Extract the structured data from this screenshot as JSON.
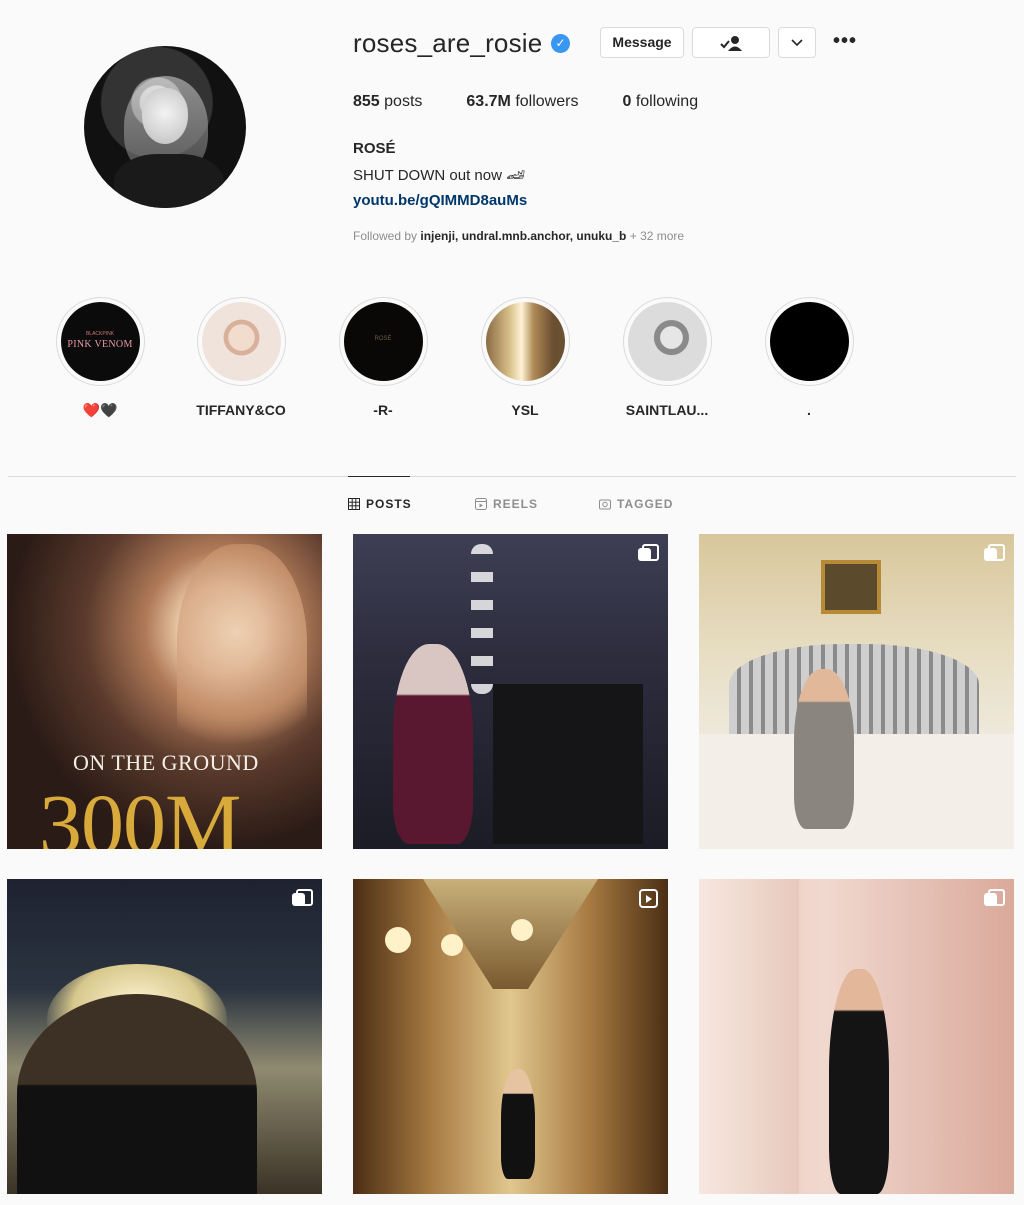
{
  "profile": {
    "username": "roses_are_rosie",
    "verified": true,
    "buttons": {
      "message": "Message"
    },
    "stats": {
      "posts": "855",
      "posts_label": "posts",
      "followers": "63.7M",
      "followers_label": "followers",
      "following": "0",
      "following_label": "following"
    },
    "full_name": "ROSÉ",
    "bio": "SHUT DOWN out now 🏎",
    "link": "youtu.be/gQIMMD8auMs",
    "followed_by_prefix": "Followed by",
    "followed_by_names": "injenji, undral.mnb.anchor, unuku_b",
    "followed_by_more": "+ 32 more"
  },
  "highlights": [
    {
      "label": "❤️🖤",
      "cover_text": "PINK VENOM",
      "cover_sub": "BLACKPINK"
    },
    {
      "label": "TIFFANY&CO"
    },
    {
      "label": "-R-",
      "cover_text": "ROSÉ"
    },
    {
      "label": "YSL"
    },
    {
      "label": "SAINTLAU..."
    },
    {
      "label": "."
    }
  ],
  "tabs": [
    {
      "label": "POSTS",
      "active": true,
      "icon": "grid-icon"
    },
    {
      "label": "REELS",
      "active": false,
      "icon": "reels-icon"
    },
    {
      "label": "TAGGED",
      "active": false,
      "icon": "tagged-icon"
    }
  ],
  "posts": [
    {
      "overlay_line1": "ON THE GROUND",
      "overlay_line2": "300M",
      "badge": "none"
    },
    {
      "badge": "multi-icon"
    },
    {
      "badge": "multi-icon"
    },
    {
      "badge": "multi-icon"
    },
    {
      "badge": "reel-icon"
    },
    {
      "badge": "multi-icon"
    }
  ],
  "colors": {
    "verified": "#3897f0",
    "link": "#00376b",
    "views_gold": "#d8a93b"
  }
}
